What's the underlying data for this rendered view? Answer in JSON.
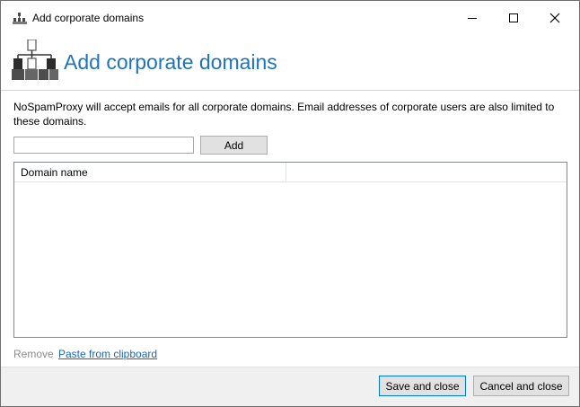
{
  "window": {
    "title": "Add corporate domains",
    "controls": {
      "minimize": "minimize",
      "maximize": "maximize",
      "close": "close"
    }
  },
  "header": {
    "title": "Add corporate domains",
    "icon": "network-hierarchy-icon"
  },
  "description": "NoSpamProxy will accept emails for all corporate domains. Email addresses of corporate users are also limited to these domains.",
  "input": {
    "value": "",
    "placeholder": ""
  },
  "buttons": {
    "add": "Add",
    "save": "Save and close",
    "cancel": "Cancel and close"
  },
  "list": {
    "columns": [
      "Domain name",
      ""
    ],
    "rows": []
  },
  "links": {
    "remove": "Remove",
    "paste": "Paste from clipboard"
  },
  "colors": {
    "accent": "#1e73be",
    "link": "#1a66b8",
    "disabled": "#8c8c8c",
    "footer": "#f0f0f0",
    "focus_border": "#0078d7"
  }
}
